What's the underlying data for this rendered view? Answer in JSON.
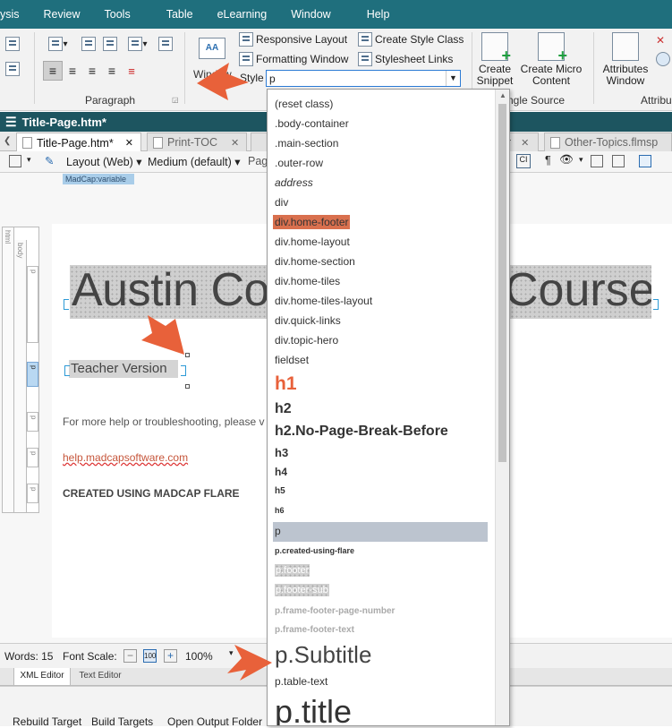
{
  "menubar": {
    "items": [
      "ysis",
      "Review",
      "Tools",
      "Table",
      "eLearning",
      "Window",
      "Help"
    ]
  },
  "ribbon": {
    "paragraph_label": "Paragraph",
    "responsive_layout": "Responsive Layout",
    "formatting_window": "Formatting Window",
    "create_style_class": "Create Style Class",
    "stylesheet_links": "Stylesheet Links",
    "style_label": "Style",
    "style_value": "p",
    "window_partial": "Window",
    "create_snippet": "Create Snippet",
    "create_micro_content": "Create Micro Content",
    "single_source_label": "ngle Source",
    "attributes_window": "Attributes Window",
    "attributes_label": "Attribu"
  },
  "document": {
    "title": "Title-Page.htm*",
    "tabs": [
      "Title-Page.htm*",
      "Print-TOC",
      "r",
      "Other-Topics.flmsp"
    ],
    "layout_label": "Layout (Web)",
    "medium_label": "Medium (default)",
    "page_partial": "Pag",
    "variable_tag": "MadCap:variable",
    "structure_labels": {
      "html": "html",
      "body": "body",
      "p": "p"
    },
    "heading_partial_left": "Austin Co",
    "heading_partial_right": "Course",
    "subtitle": "Teacher Version",
    "help_text": "For more help or troubleshooting, please v",
    "help_link": "help.madcapsoftware.com",
    "created_using": "CREATED USING MADCAP FLARE"
  },
  "status": {
    "words": "Words: 15",
    "font_scale": "Font Scale:",
    "zoom": "100%"
  },
  "bottom_tabs": [
    "XML Editor",
    "Text Editor"
  ],
  "bottom_toolbar": [
    "Rebuild Target",
    "Build Targets",
    "Open Output Folder"
  ],
  "dropdown": {
    "options": [
      {
        "label": "(reset class)"
      },
      {
        "label": ".body-container"
      },
      {
        "label": ".main-section"
      },
      {
        "label": ".outer-row"
      },
      {
        "label": "address"
      },
      {
        "label": "div"
      },
      {
        "label": "div.home-footer"
      },
      {
        "label": "div.home-layout"
      },
      {
        "label": "div.home-section"
      },
      {
        "label": "div.home-tiles"
      },
      {
        "label": "div.home-tiles-layout"
      },
      {
        "label": "div.quick-links"
      },
      {
        "label": "div.topic-hero"
      },
      {
        "label": "fieldset"
      },
      {
        "label": "h1"
      },
      {
        "label": "h2"
      },
      {
        "label": "h2.No-Page-Break-Before"
      },
      {
        "label": "h3"
      },
      {
        "label": "h4"
      },
      {
        "label": "h5"
      },
      {
        "label": "h6"
      },
      {
        "label": "p"
      },
      {
        "label": "p.created-using-flare"
      },
      {
        "label": "p.footer"
      },
      {
        "label": "p.footer-sub"
      },
      {
        "label": "p.frame-footer-page-number"
      },
      {
        "label": "p.frame-footer-text"
      },
      {
        "label": "p.Subtitle"
      },
      {
        "label": "p.table-text"
      },
      {
        "label": "p.title"
      }
    ]
  },
  "colors": {
    "menubar": "#1f6f7d",
    "doc_title_bar": "#1d5560",
    "accent_orange": "#e8613a",
    "selection": "#bcc4cf"
  }
}
